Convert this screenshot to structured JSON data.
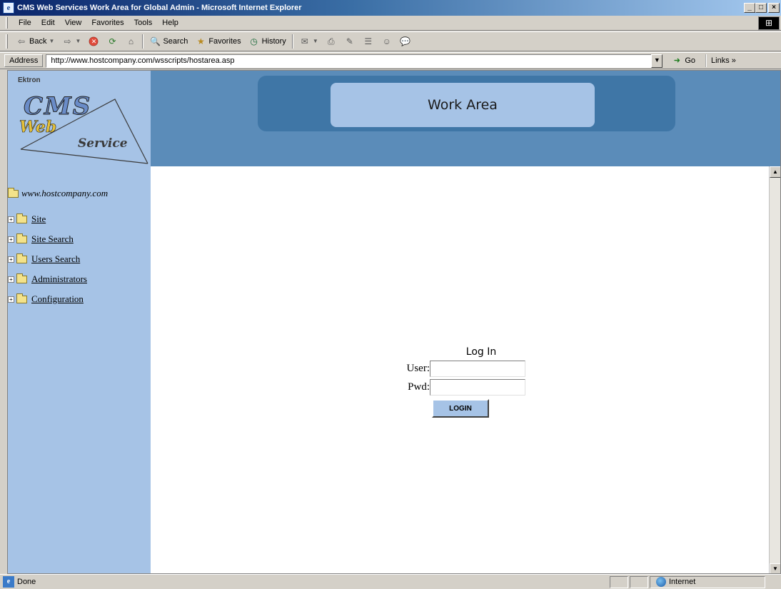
{
  "window": {
    "title": "CMS Web Services Work Area for Global Admin - Microsoft Internet Explorer",
    "controls": {
      "minimize": "_",
      "maximize": "□",
      "close": "×"
    }
  },
  "menu": {
    "items": [
      "File",
      "Edit",
      "View",
      "Favorites",
      "Tools",
      "Help"
    ]
  },
  "toolbar": {
    "back": "Back",
    "search": "Search",
    "favorites": "Favorites",
    "history": "History"
  },
  "address": {
    "label": "Address",
    "url": "http://www.hostcompany.com/wsscripts/hostarea.asp",
    "go": "Go",
    "links": "Links »"
  },
  "header": {
    "logo_brand": "Ektron",
    "logo_cms": "CMS",
    "logo_web": "Web",
    "logo_service": "Service",
    "banner_title": "Work Area"
  },
  "sidebar": {
    "root": "www.hostcompany.com",
    "items": [
      {
        "label": "Site"
      },
      {
        "label": "Site Search"
      },
      {
        "label": "Users Search"
      },
      {
        "label": "Administrators"
      },
      {
        "label": "Configuration"
      }
    ]
  },
  "login": {
    "title": "Log In",
    "user_label": "User:",
    "pwd_label": "Pwd:",
    "button": "LOGIN"
  },
  "status": {
    "text": "Done",
    "zone": "Internet"
  },
  "colors": {
    "sidebar_bg": "#a6c3e6",
    "header_bg": "#5b8cb9",
    "banner_dark": "#3f76a6"
  }
}
